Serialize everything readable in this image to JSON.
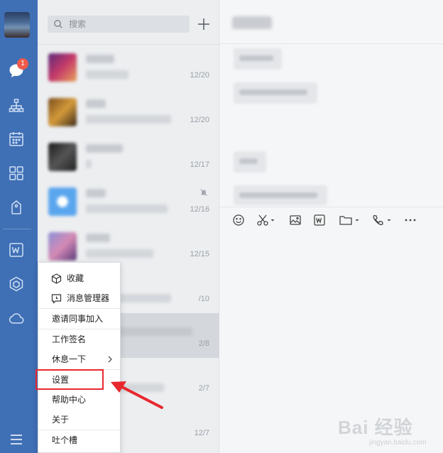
{
  "sidebar": {
    "badge_count": "1",
    "icons": [
      "chat-icon",
      "org-chart-icon",
      "calendar-icon",
      "apps-grid-icon",
      "drive-tag-icon",
      "wps-doc-icon",
      "box-icon",
      "cloud-icon",
      "menu-icon"
    ],
    "accent_color": "#3f6fb5",
    "badge_color": "#f05a4b"
  },
  "chat_list": {
    "search_placeholder": "搜索",
    "items": [
      {
        "time": "12/20"
      },
      {
        "time": "12/20"
      },
      {
        "time": "12/17"
      },
      {
        "time": "12/16",
        "muted": true
      },
      {
        "time": "12/15"
      },
      {
        "time": "/10"
      },
      {
        "time": "2/8"
      },
      {
        "time": "2/7"
      },
      {
        "time": "12/7"
      }
    ]
  },
  "context_menu": {
    "items": [
      {
        "label": "收藏",
        "icon": "cube-icon"
      },
      {
        "label": "消息管理器",
        "icon": "message-manager-icon"
      },
      {
        "label": "邀请同事加入"
      },
      {
        "label": "工作签名"
      },
      {
        "label": "休息一下",
        "has_submenu": true
      },
      {
        "label": "设置",
        "highlighted": true
      },
      {
        "label": "帮助中心"
      },
      {
        "label": "关于"
      },
      {
        "label": "吐个槽"
      }
    ],
    "highlight_color": "#e8282e"
  },
  "toolbar": {
    "icons": [
      "emoji-icon",
      "scissors-icon",
      "image-icon",
      "wps-icon",
      "folder-icon",
      "phone-icon",
      "more-icon"
    ]
  },
  "watermark": {
    "text": "Bai 经验",
    "sub": "jingyan.baidu.com"
  }
}
